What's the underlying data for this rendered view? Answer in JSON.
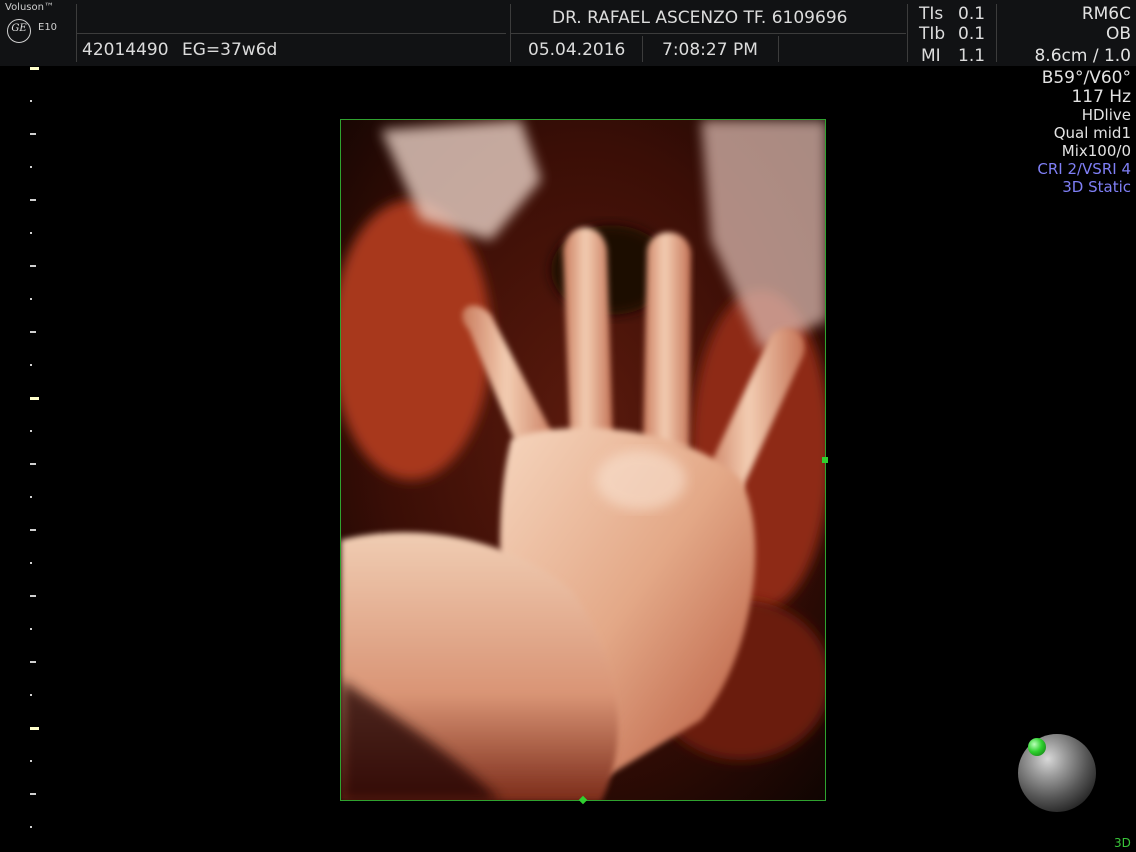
{
  "header": {
    "brand": "Voluson™",
    "logo": "GE",
    "model": "E10",
    "patient_id": "42014490",
    "gestational_age": "EG=37w6d",
    "doctor": "DR. RAFAEL ASCENZO TF. 6109696",
    "date": "05.04.2016",
    "time": "7:08:27 PM",
    "indices": [
      {
        "label": "TIs",
        "value": "0.1"
      },
      {
        "label": "TIb",
        "value": "0.1"
      },
      {
        "label": "MI",
        "value": "1.1"
      }
    ]
  },
  "params": {
    "probe": "RM6C",
    "preset": "OB",
    "depth": "8.6cm / 1.0",
    "angle": "B59°/V60°",
    "frame_rate": "117 Hz",
    "render_mode": "HDlive",
    "quality": "Qual mid1",
    "mix": "Mix100/0",
    "cri": "CRI 2/VSRI 4",
    "mode": "3D Static"
  },
  "footer": {
    "mode_label": "3D"
  },
  "colors": {
    "roi_border": "#2fa22f",
    "accent_blue": "#7f7ff5",
    "background": "#000000",
    "header_bg": "#111214"
  },
  "icons": {
    "logo": "ge-logo-icon",
    "orientation": "orientation-sphere-icon"
  }
}
